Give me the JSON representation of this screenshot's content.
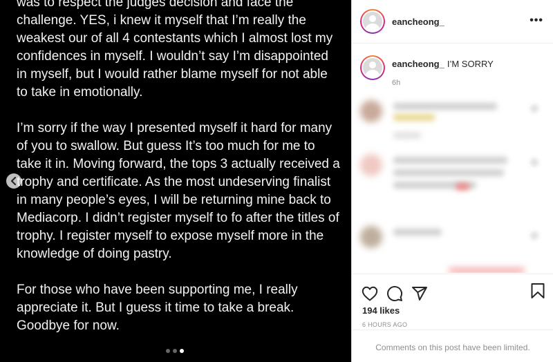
{
  "post": {
    "paragraphs": [
      "was to respect the judges decision and face the challenge. YES, i knew it myself that I’m really the weakest our of all 4 contestants which I almost lost my confidences in myself.  I wouldn’t say I’m disappointed in myself, but I would rather blame myself for not able to take in emotionally.",
      "I’m sorry if the way I presented myself it hard for many of you to swallow. But guess It’s too much for me to take it in. Moving forward, the tops 3 actually received a trophy and certificate. As the most undeserving finalist in many people’s eyes, I will be returning mine back to Mediacorp. I didn’t register myself to fo after the titles of trophy. I register myself to expose myself more in the knowledge of doing pastry.",
      "For those who have been supporting me, I really appreciate it. But I guess it time to take a break. Goodbye for now."
    ],
    "carousel": {
      "total": 3,
      "active": 3
    }
  },
  "header": {
    "username": "eancheong_",
    "more_icon": "more-horizontal-icon",
    "more_label": "•••"
  },
  "caption": {
    "username": "eancheong_",
    "text": "I’M SORRY",
    "time": "6h"
  },
  "actions": {
    "icons": [
      "heart-icon",
      "comment-icon",
      "share-icon",
      "bookmark-icon"
    ],
    "likes": "194 likes",
    "timestamp": "6 HOURS AGO",
    "limited_notice": "Comments on this post have been limited."
  },
  "colors": {
    "post_bg": "#000000",
    "post_text": "#f2f2f2",
    "story_ring_start": "#f58529",
    "story_ring_end": "#dd2a7b",
    "secondary_text": "#8e8e8e"
  }
}
